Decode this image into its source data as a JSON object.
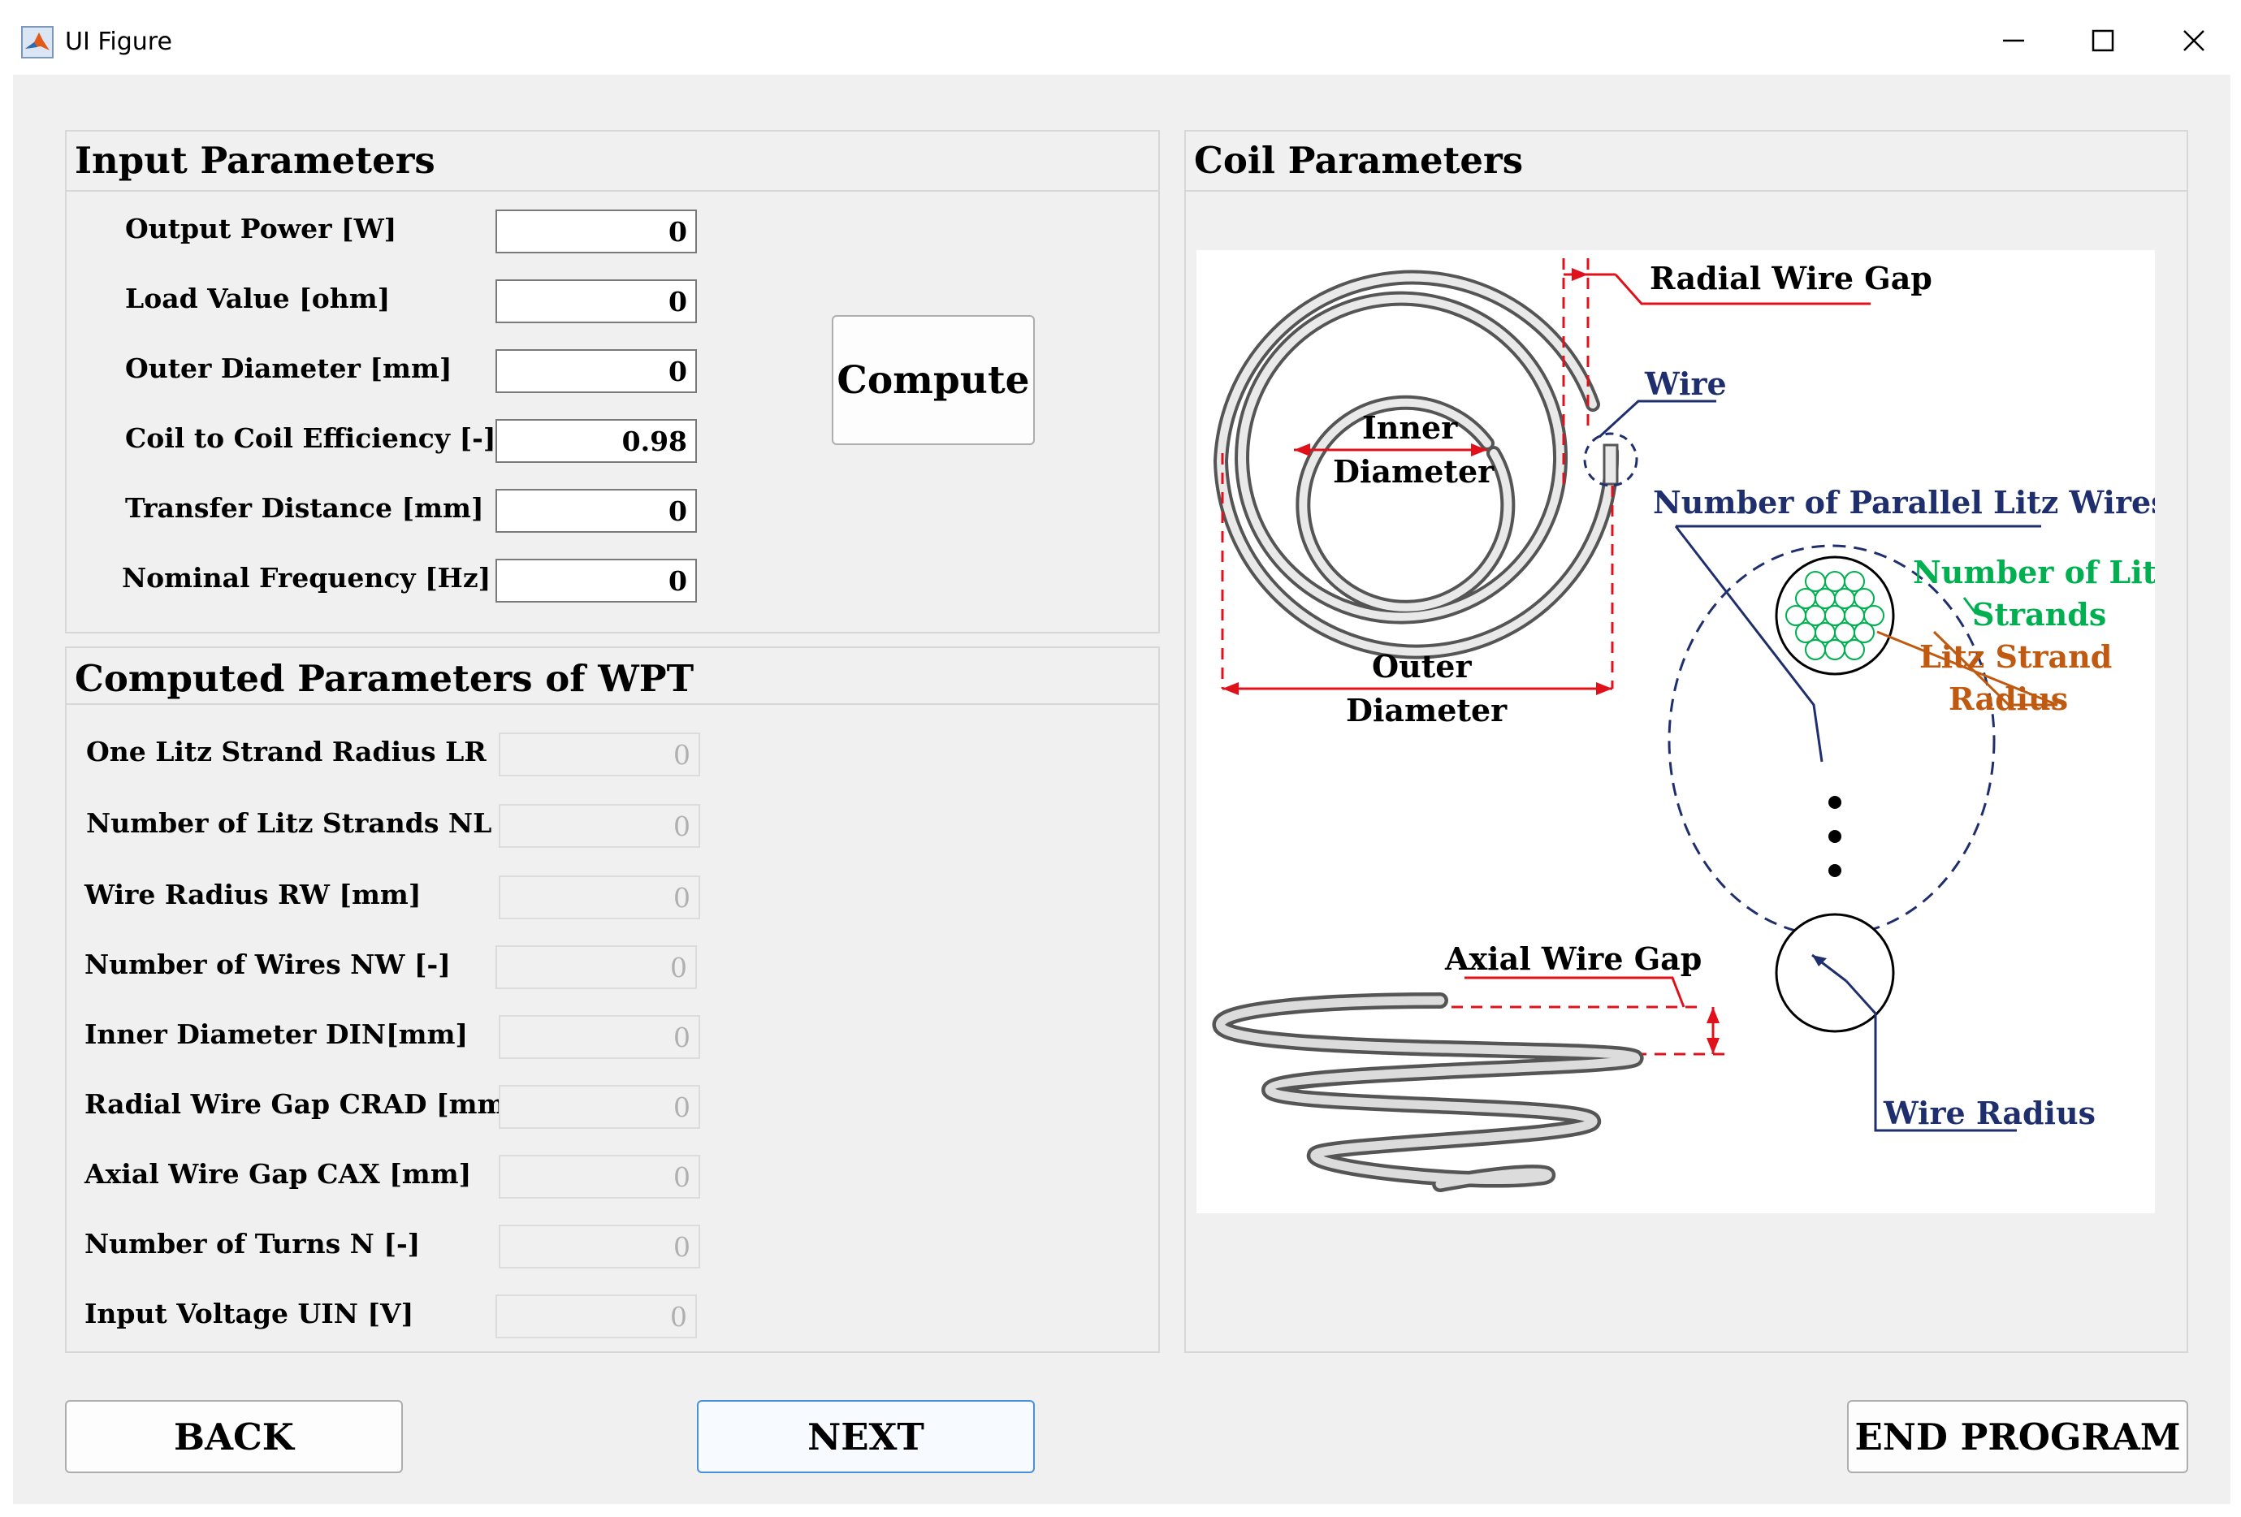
{
  "window": {
    "title": "UI Figure",
    "controls": {
      "minimize": "—",
      "maximize": "☐",
      "close": "✕"
    }
  },
  "input_panel": {
    "title": "Input Parameters",
    "fields": [
      {
        "label": "Output Power [W]",
        "value": "0"
      },
      {
        "label": "Load Value [ohm]",
        "value": "0"
      },
      {
        "label": "Outer Diameter [mm]",
        "value": "0"
      },
      {
        "label": "Coil to Coil Efficiency [-]",
        "value": "0.98"
      },
      {
        "label": "Transfer Distance [mm]",
        "value": "0"
      },
      {
        "label": "Nominal Frequency [Hz]",
        "value": "0"
      }
    ],
    "compute_label": "Compute"
  },
  "computed_panel": {
    "title": "Computed Parameters of WPT",
    "fields": [
      {
        "label": "One Litz Strand Radius LR [mm]",
        "value": "0"
      },
      {
        "label": "Number of Litz Strands NL [-]",
        "value": "0"
      },
      {
        "label": "Wire Radius RW [mm]",
        "value": "0"
      },
      {
        "label": "Number of Wires NW  [-]",
        "value": "0"
      },
      {
        "label": "Inner Diameter DIN[mm]",
        "value": "0"
      },
      {
        "label": "Radial Wire Gap CRAD [mm]",
        "value": "0"
      },
      {
        "label": "Axial Wire Gap CAX [mm]",
        "value": "0"
      },
      {
        "label": "Number of Turns N [-]",
        "value": "0"
      },
      {
        "label": "Input Voltage UIN [V]",
        "value": "0"
      }
    ]
  },
  "coil_panel": {
    "title": "Coil Parameters",
    "diagram": {
      "radial_gap": "Radial Wire Gap",
      "wire": "Wire",
      "inner_diameter_1": "Inner",
      "inner_diameter_2": "Diameter",
      "outer_diameter_1": "Outer",
      "outer_diameter_2": "Diameter",
      "parallel_wires": "Number of Parallel Litz Wires",
      "litz_strands_1": "Number of Litz",
      "litz_strands_2": "Strands",
      "strand_radius_1": "Litz Strand",
      "strand_radius_2": "Radius",
      "axial_gap": "Axial Wire Gap",
      "wire_radius": "Wire Radius"
    },
    "colors": {
      "dimension": "#e0111b",
      "wire_label": "#1f2f6e",
      "strands": "#00b050",
      "strand_radius": "#c05a10"
    }
  },
  "buttons": {
    "back": "BACK",
    "next": "NEXT",
    "end": "END PROGRAM"
  }
}
